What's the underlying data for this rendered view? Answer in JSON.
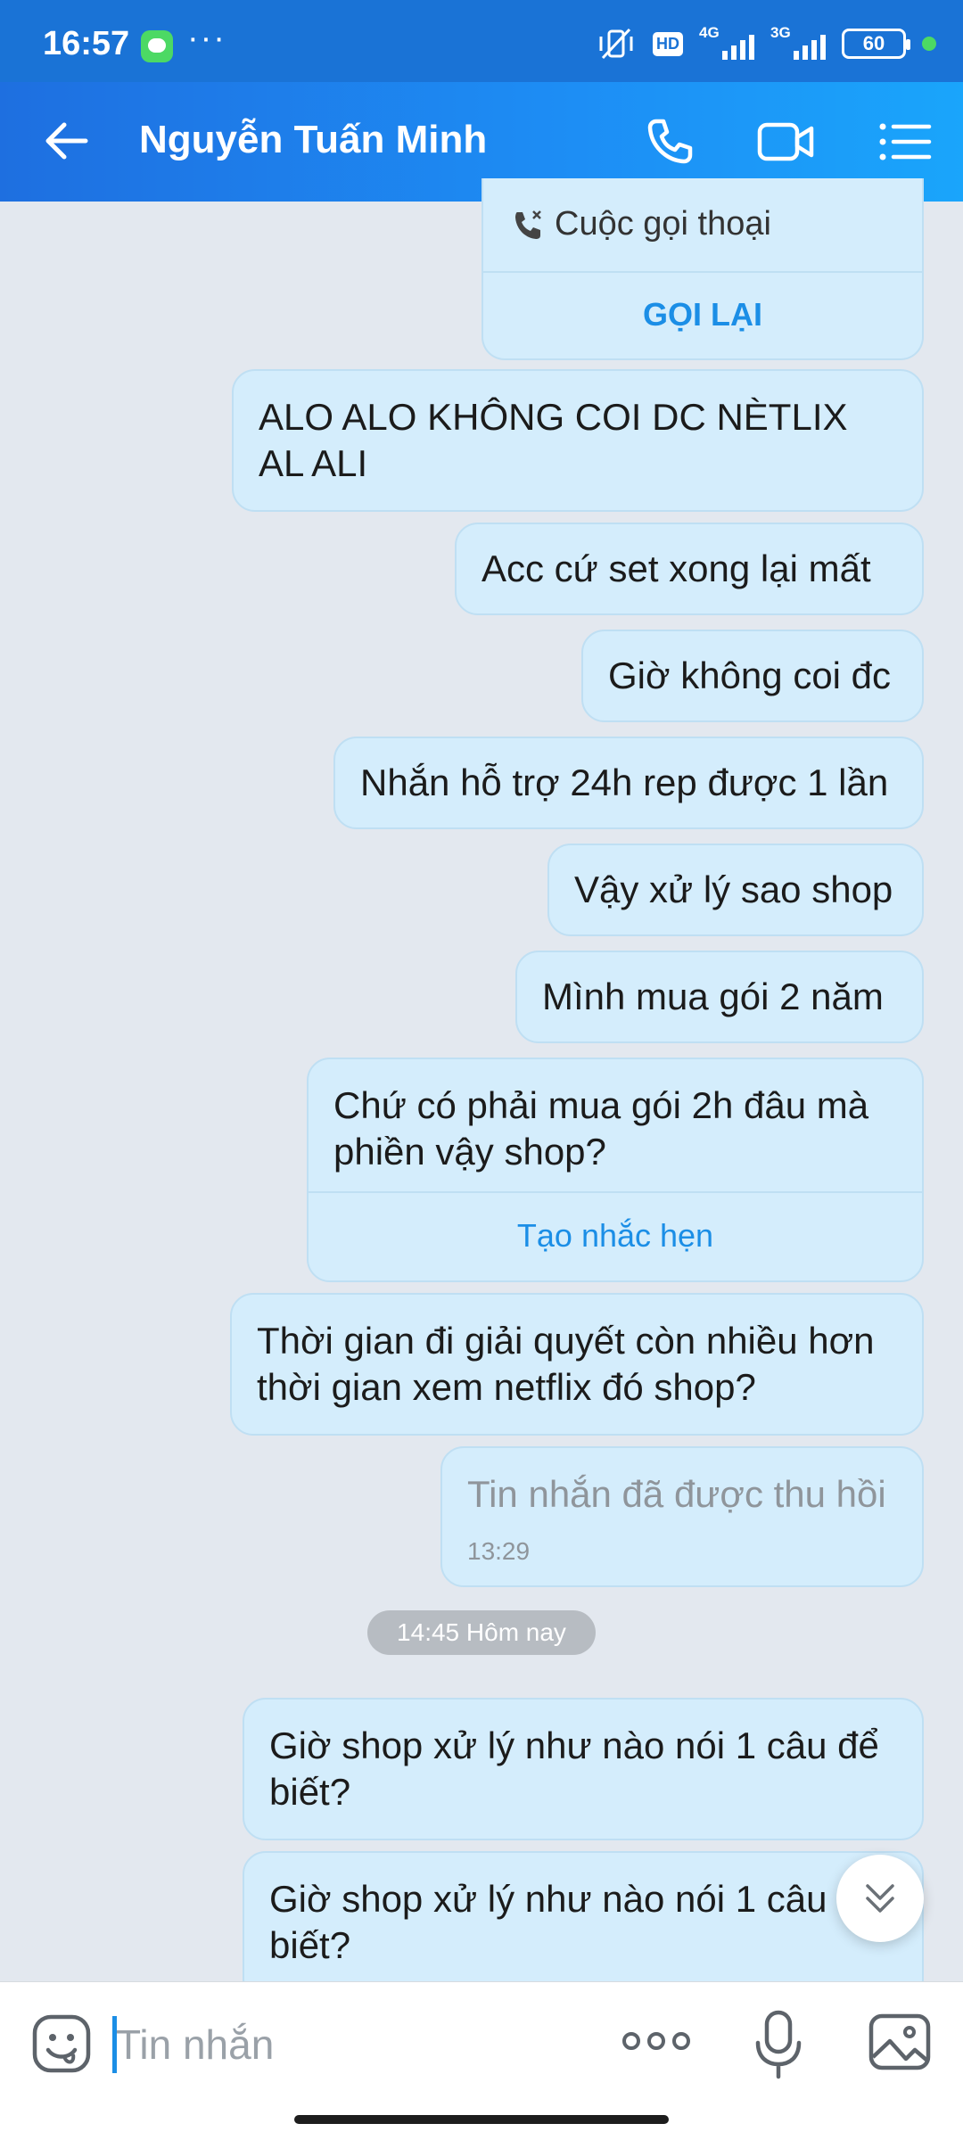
{
  "status_bar": {
    "time": "16:57",
    "more": "···",
    "hd": "HD",
    "net1": "4G",
    "net2": "3G",
    "battery": "60"
  },
  "header": {
    "contact_name": "Nguyễn Tuấn Minh",
    "icons": [
      "back-arrow-icon",
      "phone-icon",
      "video-call-icon",
      "menu-list-icon"
    ]
  },
  "colors": {
    "header_start": "#1e6fe0",
    "header_end": "#1aa5fb",
    "bubble_bg": "#d4edfc",
    "link": "#1b8ee6",
    "chat_bg": "#e3e8ef"
  },
  "call_card": {
    "label": "Cuộc gọi thoại",
    "action": "GỌI LẠI"
  },
  "messages": [
    {
      "text": "ALO ALO KHÔNG COI DC NÈTLIX AL ALI"
    },
    {
      "text": "Acc cứ set xong lại mất"
    },
    {
      "text": "Giờ không coi đc"
    },
    {
      "text": "Nhắn hỗ trợ 24h rep được 1 lần"
    },
    {
      "text": "Vậy xử lý sao shop"
    },
    {
      "text": "Mình mua gói 2 năm"
    },
    {
      "text": "Chứ có phải mua gói 2h đâu mà phiền vậy shop?",
      "action": "Tạo nhắc hẹn"
    },
    {
      "text": "Thời gian đi giải quyết còn nhiều hơn thời gian xem netflix đó shop?"
    },
    {
      "text": "Tin nhắn đã được thu hồi",
      "time": "13:29",
      "recalled": true
    },
    {
      "text": "Giờ shop xử lý như nào nói 1 câu để biết?"
    },
    {
      "text": "Giờ shop xử lý như nào nói 1 câu để biết?"
    }
  ],
  "date_separator": "14:45 Hôm nay",
  "input": {
    "placeholder": "Tin nhắn"
  }
}
